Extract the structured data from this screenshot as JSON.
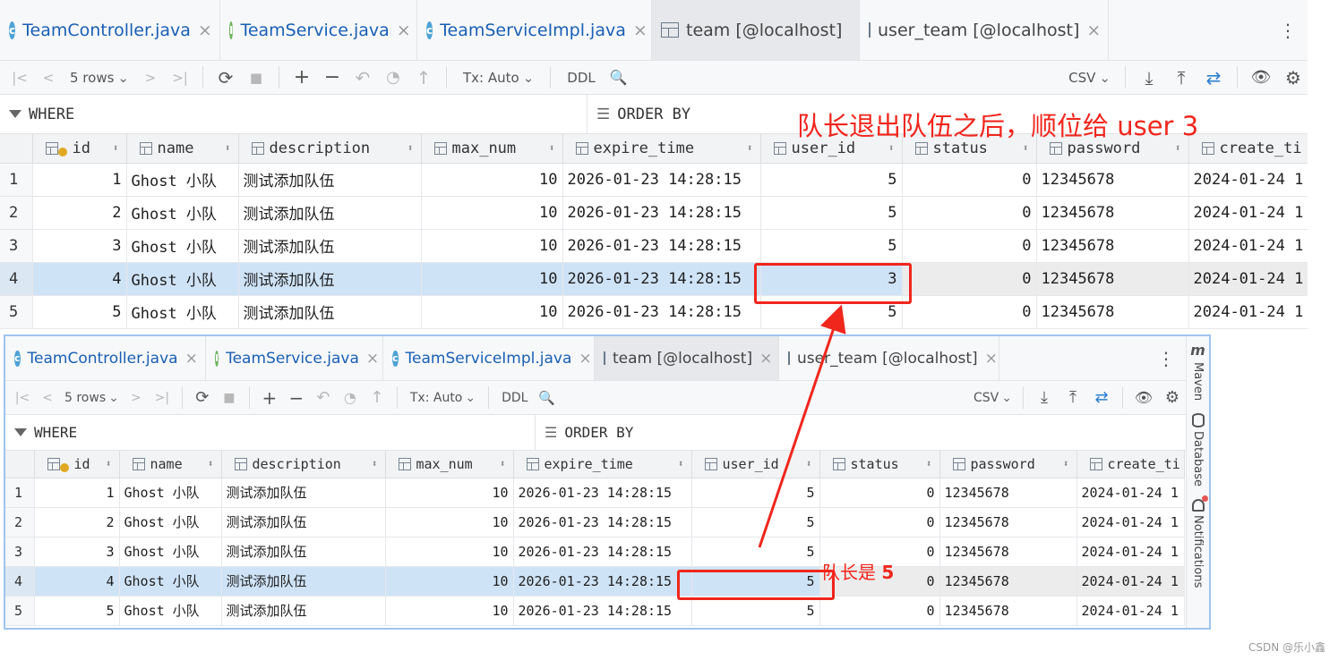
{
  "tabs": [
    {
      "label": "TeamController.java",
      "kind": "C",
      "close": "×"
    },
    {
      "label": "TeamService.java",
      "kind": "I",
      "close": "×"
    },
    {
      "label": "TeamServiceImpl.java",
      "kind": "C",
      "close": "×"
    },
    {
      "label": "team [@localhost]",
      "kind": "table",
      "close": "×",
      "active": true
    },
    {
      "label": "user_team [@localhost]",
      "kind": "table",
      "close": "×"
    }
  ],
  "tab_more": "⋮",
  "toolbar": {
    "first": "|<",
    "prev": "<",
    "rows": "5 rows",
    "next": ">",
    "last": ">|",
    "reload": "⟳",
    "stop": "■",
    "add": "+",
    "remove": "−",
    "revert": "↶",
    "preview": "◔",
    "submit": "↑",
    "tx": "Tx: Auto",
    "ddl": "DDL",
    "search": "🔍",
    "csv": "CSV",
    "download": "⤓",
    "upload": "⤒",
    "compare": "⇄",
    "view": "👁",
    "settings": "⚙",
    "caret": "⌄"
  },
  "filter": {
    "where": "WHERE",
    "order_by": "ORDER BY"
  },
  "columns": [
    "id",
    "name",
    "description",
    "max_num",
    "expire_time",
    "user_id",
    "status",
    "password",
    "create_ti"
  ],
  "rows_after": [
    [
      "1",
      "1",
      "Ghost 小队",
      "测试添加队伍",
      "10",
      "2026-01-23 14:28:15",
      "5",
      "0",
      "12345678",
      "2024-01-24 1"
    ],
    [
      "2",
      "2",
      "Ghost 小队",
      "测试添加队伍",
      "10",
      "2026-01-23 14:28:15",
      "5",
      "0",
      "12345678",
      "2024-01-24 1"
    ],
    [
      "3",
      "3",
      "Ghost 小队",
      "测试添加队伍",
      "10",
      "2026-01-23 14:28:15",
      "5",
      "0",
      "12345678",
      "2024-01-24 1"
    ],
    [
      "4",
      "4",
      "Ghost 小队",
      "测试添加队伍",
      "10",
      "2026-01-23 14:28:15",
      "3",
      "0",
      "12345678",
      "2024-01-24 1"
    ],
    [
      "5",
      "5",
      "Ghost 小队",
      "测试添加队伍",
      "10",
      "2026-01-23 14:28:15",
      "5",
      "0",
      "12345678",
      "2024-01-24 1"
    ]
  ],
  "rows_before": [
    [
      "1",
      "1",
      "Ghost 小队",
      "测试添加队伍",
      "10",
      "2026-01-23 14:28:15",
      "5",
      "0",
      "12345678",
      "2024-01-24 1"
    ],
    [
      "2",
      "2",
      "Ghost 小队",
      "测试添加队伍",
      "10",
      "2026-01-23 14:28:15",
      "5",
      "0",
      "12345678",
      "2024-01-24 1"
    ],
    [
      "3",
      "3",
      "Ghost 小队",
      "测试添加队伍",
      "10",
      "2026-01-23 14:28:15",
      "5",
      "0",
      "12345678",
      "2024-01-24 1"
    ],
    [
      "4",
      "4",
      "Ghost 小队",
      "测试添加队伍",
      "10",
      "2026-01-23 14:28:15",
      "5",
      "0",
      "12345678",
      "2024-01-24 1"
    ],
    [
      "5",
      "5",
      "Ghost 小队",
      "测试添加队伍",
      "10",
      "2026-01-23 14:28:15",
      "5",
      "0",
      "12345678",
      "2024-01-24 1"
    ]
  ],
  "selected_row": 4,
  "side": {
    "maven": "Maven",
    "database": "Database",
    "notifications": "Notifications",
    "maven_logo": "m"
  },
  "annotations": {
    "top": "队长退出队伍之后，顺位给 user 3",
    "bottom_prefix": "队长是 ",
    "bottom_value": "5"
  },
  "watermark": "CSDN @乐小鑫",
  "colors": {
    "annotation": "#f0261d",
    "selection": "#cfe3f7",
    "tab_text": "#1a5fb4"
  }
}
